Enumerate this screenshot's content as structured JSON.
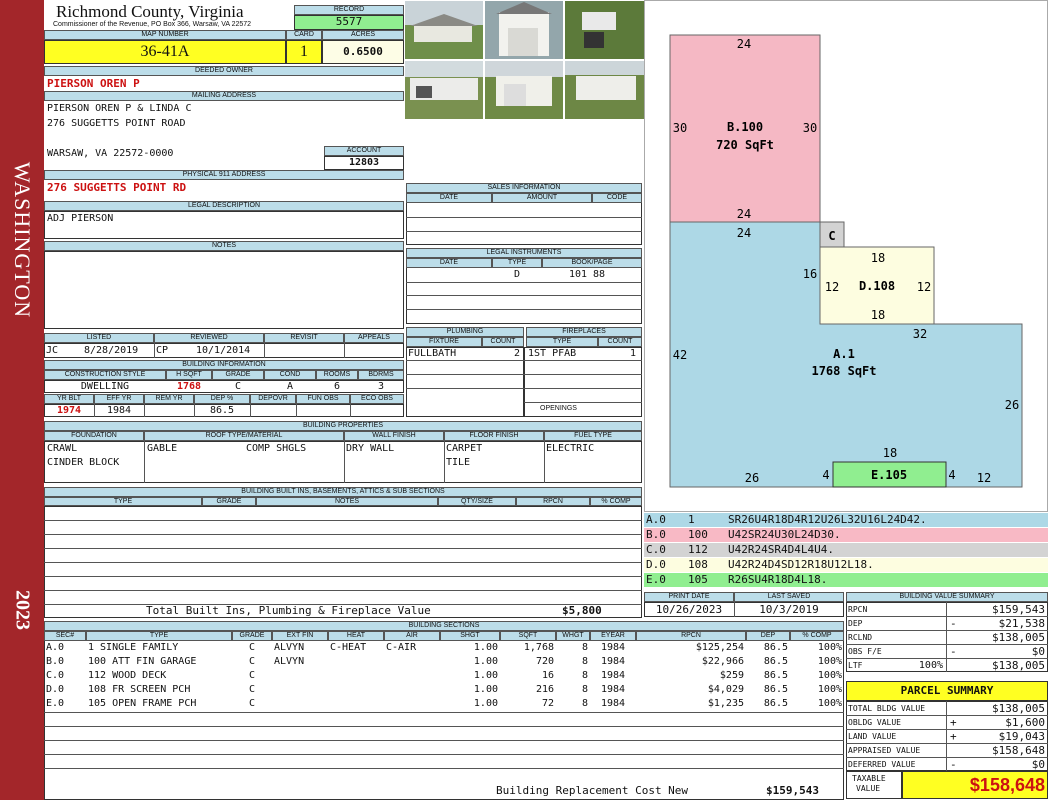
{
  "sidebar": {
    "label": "WASHINGTON",
    "year": "2023"
  },
  "header": {
    "county": "Richmond County, Virginia",
    "commissioner": "Commissioner of the Revenue, PO Box 366, Warsaw, VA 22572",
    "record_label": "RECORD",
    "record": "5577",
    "map_label": "MAP NUMBER",
    "map": "36-41A",
    "card_label": "CARD",
    "card": "1",
    "acres_label": "ACRES",
    "acres": "0.6500"
  },
  "owner": {
    "deeded_label": "DEEDED OWNER",
    "deeded": "PIERSON OREN P",
    "mailing_label": "MAILING ADDRESS",
    "mailing_1": "PIERSON OREN P & LINDA C",
    "mailing_2": "276 SUGGETTS POINT ROAD",
    "mailing_3": "WARSAW, VA 22572-0000",
    "account_label": "ACCOUNT",
    "account": "12803",
    "physical_label": "PHYSICAL 911 ADDRESS",
    "physical": "276 SUGGETTS POINT RD",
    "legal_label": "LEGAL DESCRIPTION",
    "legal": "ADJ PIERSON",
    "notes_label": "NOTES"
  },
  "sales": {
    "title": "SALES INFORMATION",
    "cols": [
      "DATE",
      "AMOUNT",
      "CODE"
    ]
  },
  "legal_instruments": {
    "title": "LEGAL INSTRUMENTS",
    "cols": [
      "DATE",
      "TYPE",
      "BOOK/PAGE"
    ],
    "type": "D",
    "bookpage": "101 88"
  },
  "listing": {
    "listed_label": "LISTED",
    "reviewed_label": "REVIEWED",
    "revisit_label": "REVISIT",
    "appeals_label": "APPEALS",
    "listed_by": "JC",
    "listed_date": "8/28/2019",
    "reviewed_by": "CP",
    "reviewed_date": "10/1/2014"
  },
  "building_info": {
    "title": "BUILDING INFORMATION",
    "h1": [
      "CONSTRUCTION STYLE",
      "H SQFT",
      "GRADE",
      "COND",
      "ROOMS",
      "BDRMS"
    ],
    "v1": [
      "DWELLING",
      "1768",
      "C",
      "A",
      "6",
      "3"
    ],
    "h2": [
      "YR BLT",
      "EFF YR",
      "REM YR",
      "DEP %",
      "DEPOVR",
      "FUN OBS",
      "ECO OBS"
    ],
    "v2": [
      "1974",
      "1984",
      "",
      "86.5",
      "",
      "",
      ""
    ]
  },
  "plumbing": {
    "title": "PLUMBING",
    "fixture_label": "FIXTURE",
    "count_label": "COUNT",
    "fixture": "FULLBATH",
    "count": "2"
  },
  "fireplaces": {
    "title": "FIREPLACES",
    "type_label": "TYPE",
    "count_label": "COUNT",
    "type": "1ST PFAB",
    "count": "1",
    "openings_label": "OPENINGS"
  },
  "properties": {
    "title": "BUILDING PROPERTIES",
    "cols": [
      "FOUNDATION",
      "ROOF TYPE/MATERIAL",
      "WALL FINISH",
      "FLOOR FINISH",
      "FUEL TYPE"
    ],
    "foundation_1": "CRAWL",
    "foundation_2": "CINDER BLOCK",
    "roof_type": "GABLE",
    "roof_material": "COMP SHGLS",
    "wall": "DRY WALL",
    "floor_1": "CARPET",
    "floor_2": "TILE",
    "fuel": "ELECTRIC"
  },
  "builtins": {
    "title": "BUILDING BUILT INS, BASEMENTS, ATTICS & SUB SECTIONS",
    "cols": [
      "TYPE",
      "GRADE",
      "NOTES",
      "QTY/SIZE",
      "RPCN",
      "% COMP"
    ],
    "total_label": "Total Built Ins, Plumbing & Fireplace Value",
    "total": "$5,800"
  },
  "print": {
    "print_label": "PRINT DATE",
    "saved_label": "LAST SAVED",
    "print_date": "10/26/2023",
    "saved_date": "10/3/2019"
  },
  "sections": {
    "title": "BUILDING SECTIONS",
    "cols": [
      "SEC#",
      "TYPE",
      "GRADE",
      "EXT FIN",
      "HEAT",
      "AIR",
      "SHGT",
      "SQFT",
      "WHGT",
      "EYEAR",
      "RPCN",
      "DEP",
      "% COMP"
    ],
    "rows": [
      [
        "A.0",
        "1 SINGLE FAMILY",
        "C",
        "ALVYN",
        "C-HEAT",
        "C-AIR",
        "1.00",
        "1,768",
        "8",
        "1984",
        "$125,254",
        "86.5",
        "100%"
      ],
      [
        "B.0",
        "100 ATT FIN GARAGE",
        "C",
        "ALVYN",
        "",
        "",
        "1.00",
        "720",
        "8",
        "1984",
        "$22,966",
        "86.5",
        "100%"
      ],
      [
        "C.0",
        "112 WOOD DECK",
        "C",
        "",
        "",
        "",
        "1.00",
        "16",
        "8",
        "1984",
        "$259",
        "86.5",
        "100%"
      ],
      [
        "D.0",
        "108 FR SCREEN PCH",
        "C",
        "",
        "",
        "",
        "1.00",
        "216",
        "8",
        "1984",
        "$4,029",
        "86.5",
        "100%"
      ],
      [
        "E.0",
        "105 OPEN FRAME PCH",
        "C",
        "",
        "",
        "",
        "1.00",
        "72",
        "8",
        "1984",
        "$1,235",
        "86.5",
        "100%"
      ]
    ],
    "replacement_label": "Building Replacement Cost New",
    "replacement": "$159,543"
  },
  "sketch": {
    "b_label": "B.100",
    "b_area": "720 SqFt",
    "c_label": "C",
    "d_label": "D.108",
    "a_label": "A.1",
    "a_area": "1768 SqFt",
    "e_label": "E.105",
    "dims": {
      "b_top": "24",
      "b_left": "30",
      "b_right": "30",
      "b_bottom": "24",
      "a_top": "24",
      "d_top": "18",
      "a_16": "16",
      "d_left": "12",
      "d_right": "12",
      "d_bottom": "18",
      "a_32": "32",
      "a_42": "42",
      "a_26r": "26",
      "e_top": "18",
      "a_26b": "26",
      "e_4l": "4",
      "e_4r": "4",
      "a_12": "12"
    },
    "colors": {
      "a": "#add8e6",
      "b": "#f5b8c4",
      "c": "#d3d3d3",
      "d": "#fdfde0",
      "e": "#90ee90"
    }
  },
  "legend": [
    {
      "sec": "A.0",
      "code": "1",
      "path": "SR26U4R18D4R12U26L32U16L24D42.",
      "color": "#add8e6"
    },
    {
      "sec": "B.0",
      "code": "100",
      "path": "U42SR24U30L24D30.",
      "color": "#f8b9c5"
    },
    {
      "sec": "C.0",
      "code": "112",
      "path": "U42R24SR4D4L4U4.",
      "color": "#d3d3d3"
    },
    {
      "sec": "D.0",
      "code": "108",
      "path": "U42R24D4SD12R18U12L18.",
      "color": "#fdfde0"
    },
    {
      "sec": "E.0",
      "code": "105",
      "path": "R26SU4R18D4L18.",
      "color": "#90ee90"
    }
  ],
  "value_summary": {
    "title": "BUILDING VALUE SUMMARY",
    "rpcn_label": "RPCN",
    "rpcn": "$159,543",
    "dep_label": "DEP",
    "dep_sign": "-",
    "dep": "$21,538",
    "rclnd_label": "RCLND",
    "rclnd": "$138,005",
    "obs_label": "OBS F/E",
    "obs_sign": "-",
    "obs": "$0",
    "ltf_label": "LTF",
    "ltf_pct": "100%",
    "ltf": "$138,005"
  },
  "parcel": {
    "title": "PARCEL SUMMARY",
    "total_bldg_label": "TOTAL BLDG VALUE",
    "total_bldg": "$138,005",
    "obldg_label": "OBLDG VALUE",
    "obldg_sign": "+",
    "obldg": "$1,600",
    "land_label": "LAND VALUE",
    "land_sign": "+",
    "land": "$19,043",
    "appraised_label": "APPRAISED VALUE",
    "appraised": "$158,648",
    "deferred_label": "DEFERRED VALUE",
    "deferred_sign": "-",
    "deferred": "$0",
    "taxable_label_1": "TAXABLE",
    "taxable_label_2": "VALUE",
    "taxable": "$158,648"
  }
}
